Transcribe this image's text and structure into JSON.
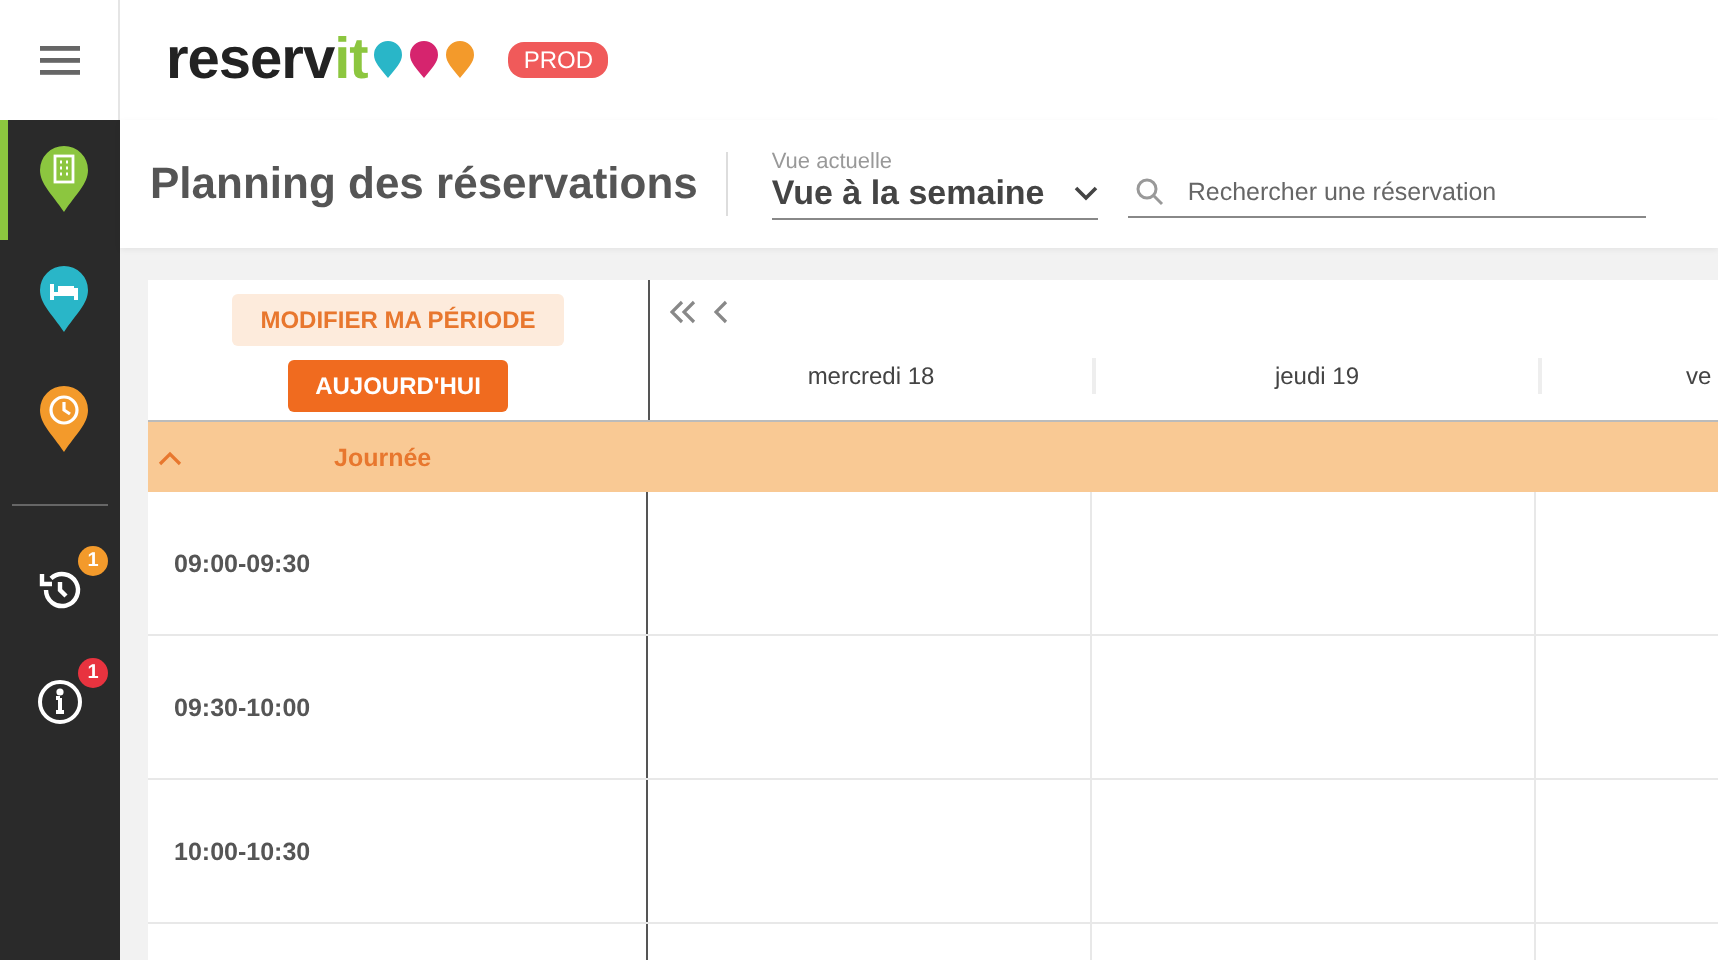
{
  "header": {
    "logo": {
      "text": "reserv",
      "accent": "it"
    },
    "env_badge": "PROD"
  },
  "sidebar": {
    "modules": [
      {
        "kind": "building",
        "color": "#8cc63f",
        "selected": true
      },
      {
        "kind": "bed",
        "color": "#29b6c8",
        "selected": false
      },
      {
        "kind": "clock",
        "color": "#f39a2b",
        "selected": false
      }
    ],
    "tools": [
      {
        "kind": "history",
        "badge": "1",
        "color": "#f39a2b"
      },
      {
        "kind": "info",
        "badge": "1",
        "color": "#e8333f"
      }
    ]
  },
  "toolbar": {
    "title": "Planning des réservations",
    "view_select": {
      "label": "Vue actuelle",
      "value": "Vue à la semaine"
    },
    "search": {
      "placeholder": "Rechercher une réservation"
    }
  },
  "calendar": {
    "period_button": "MODIFIER MA PÉRIODE",
    "today_button": "AUJOURD'HUI",
    "days": [
      "mercredi 18",
      "jeudi 19",
      "ve"
    ],
    "band": {
      "label": "Journée",
      "expanded": true
    },
    "slots": [
      "09:00-09:30",
      "09:30-10:00",
      "10:00-10:30"
    ]
  }
}
